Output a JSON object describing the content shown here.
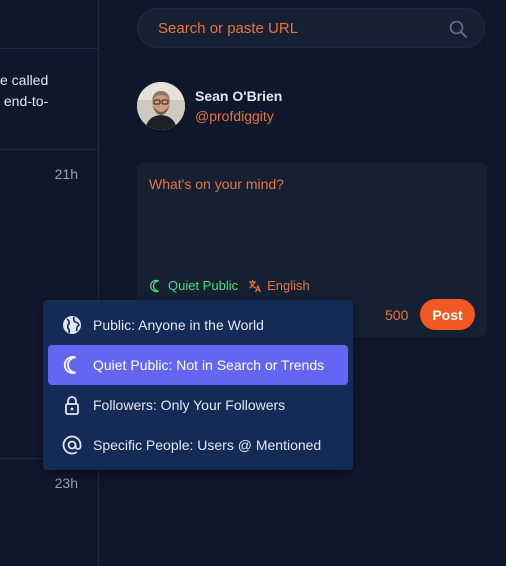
{
  "left_feed": {
    "snippet_lines": [
      "e called",
      " end-to-"
    ],
    "timestamps": [
      "21h",
      "23h"
    ]
  },
  "search": {
    "placeholder": "Search or paste URL"
  },
  "profile": {
    "name": "Sean O'Brien",
    "handle": "@profdiggity"
  },
  "composer": {
    "placeholder": "What's on your mind?",
    "visibility_label": "Quiet Public",
    "language_label": "English",
    "char_remaining": "500",
    "post_label": "Post"
  },
  "visibility_menu": {
    "items": [
      {
        "label": "Public: Anyone in the World",
        "icon": "globe-icon"
      },
      {
        "label": "Quiet Public: Not in Search or Trends",
        "icon": "moon-icon",
        "selected": true
      },
      {
        "label": "Followers: Only Your Followers",
        "icon": "lock-icon"
      },
      {
        "label": "Specific People: Users @ Mentioned",
        "icon": "at-icon"
      }
    ]
  },
  "colors": {
    "background": "#0f172b",
    "accent": "#e8743b",
    "post": "#f05a22",
    "selected": "#6366f1",
    "quiet": "#4ade80"
  }
}
